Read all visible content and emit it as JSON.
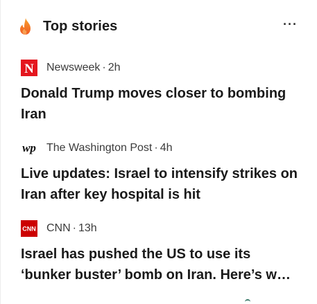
{
  "header": {
    "icon": "flame-icon",
    "title": "Top stories",
    "more_label": "···"
  },
  "stories": [
    {
      "logo": "newsweek-logo",
      "logo_text": "N",
      "source": "Newsweek",
      "sep": "·",
      "time": "2h",
      "headline": "Donald Trump moves closer to bombing Iran"
    },
    {
      "logo": "washington-post-logo",
      "logo_text": "wp",
      "source": "The Washington Post",
      "sep": "·",
      "time": "4h",
      "headline": "Live updates: Israel to intensify strikes on Iran after key hospital is hit"
    },
    {
      "logo": "cnn-logo",
      "logo_text": "CNN",
      "source": "CNN",
      "sep": "·",
      "time": "13h",
      "headline": "Israel has pushed the US to use its ‘bunker buster’ bomb on Iran. Here’s what to know"
    }
  ],
  "colors": {
    "flame_orange": "#f36f21",
    "newsweek_red": "#e4161e",
    "cnn_red": "#cc0000"
  }
}
